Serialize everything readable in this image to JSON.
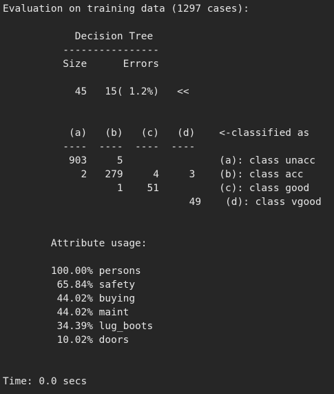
{
  "terminal": {
    "lines": [
      "Evaluation on training data (1297 cases):",
      "",
      "            Decision Tree",
      "          ----------------",
      "          Size      Errors",
      "",
      "            45   15( 1.2%)   <<",
      "",
      "",
      "           (a)   (b)   (c)   (d)    <-classified as",
      "          ----  ----  ----  ----",
      "           903     5                (a): class unacc",
      "             2   279     4     3    (b): class acc",
      "                   1    51          (c): class good",
      "                               49    (d): class vgood",
      "",
      "",
      "        Attribute usage:",
      "",
      "        100.00% persons",
      "         65.84% safety",
      "         44.02% buying",
      "         44.02% maint",
      "         34.39% lug_boots",
      "         10.02% doors",
      "",
      "",
      "Time: 0.0 secs"
    ]
  }
}
